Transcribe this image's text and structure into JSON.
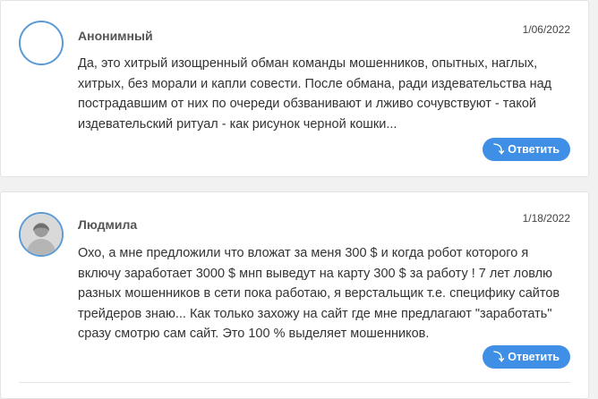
{
  "comments": [
    {
      "author": "Анонимный",
      "date": "1/06/2022",
      "text": "Да, это хитрый изощренный обман команды мошенников, опытных, наглых, хитрых, без морали и капли совести. После обмана, ради издевательства над пострадавшим от них по очереди обзванивают и лживо сочувствуют - такой издевательский ритуал - как рисунок черной кошки...",
      "reply_label": "Ответить",
      "avatar": "empty-avatar"
    },
    {
      "author": "Людмила",
      "date": "1/18/2022",
      "text": "Охо, а мне предложили что вложат за меня 300 $ и когда робот которого я включу заработает 3000 $ мнп выведут на карту 300 $ за работу ! 7 лет ловлю разных мошенников в сети пока работаю, я верстальщик т.е. специфику сайтов трейдеров знаю... Как только захожу на сайт где мне предлагают \"заработать\" сразу смотрю сам сайт. Это 100 % выделяет мошенников.",
      "reply_label": "Ответить",
      "avatar": "user-photo"
    }
  ],
  "colors": {
    "accent": "#3f8fe6",
    "avatar_border": "#5b9bd5",
    "background": "#f1f1f1"
  },
  "icons": {
    "reply": "reply-arrow-icon"
  }
}
